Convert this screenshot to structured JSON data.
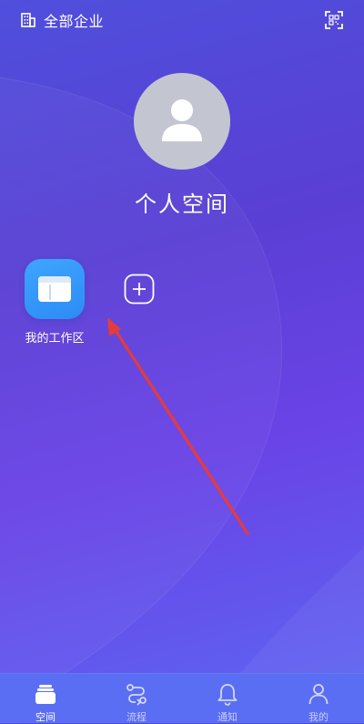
{
  "header": {
    "company_label": "全部企业",
    "company_icon": "building-icon",
    "scan_icon": "scan-icon"
  },
  "profile": {
    "avatar_icon": "user-avatar-icon",
    "title": "个人空间"
  },
  "workspace": {
    "label": "我的工作区",
    "icon": "window-icon",
    "add_icon": "plus-circle-icon"
  },
  "bottom_nav": {
    "items": [
      {
        "label": "空间",
        "icon": "space-icon",
        "active": true
      },
      {
        "label": "流程",
        "icon": "flow-icon",
        "active": false
      },
      {
        "label": "通知",
        "icon": "bell-icon",
        "active": false
      },
      {
        "label": "我的",
        "icon": "person-icon",
        "active": false
      }
    ]
  },
  "colors": {
    "background_start": "#4f4fdc",
    "background_end": "#5c67f3",
    "tile_blue": "#2c8cf5",
    "avatar_gray": "#c3c6d1",
    "annotation_arrow": "#e63b3b",
    "nav_background": "#5a6ef4"
  }
}
